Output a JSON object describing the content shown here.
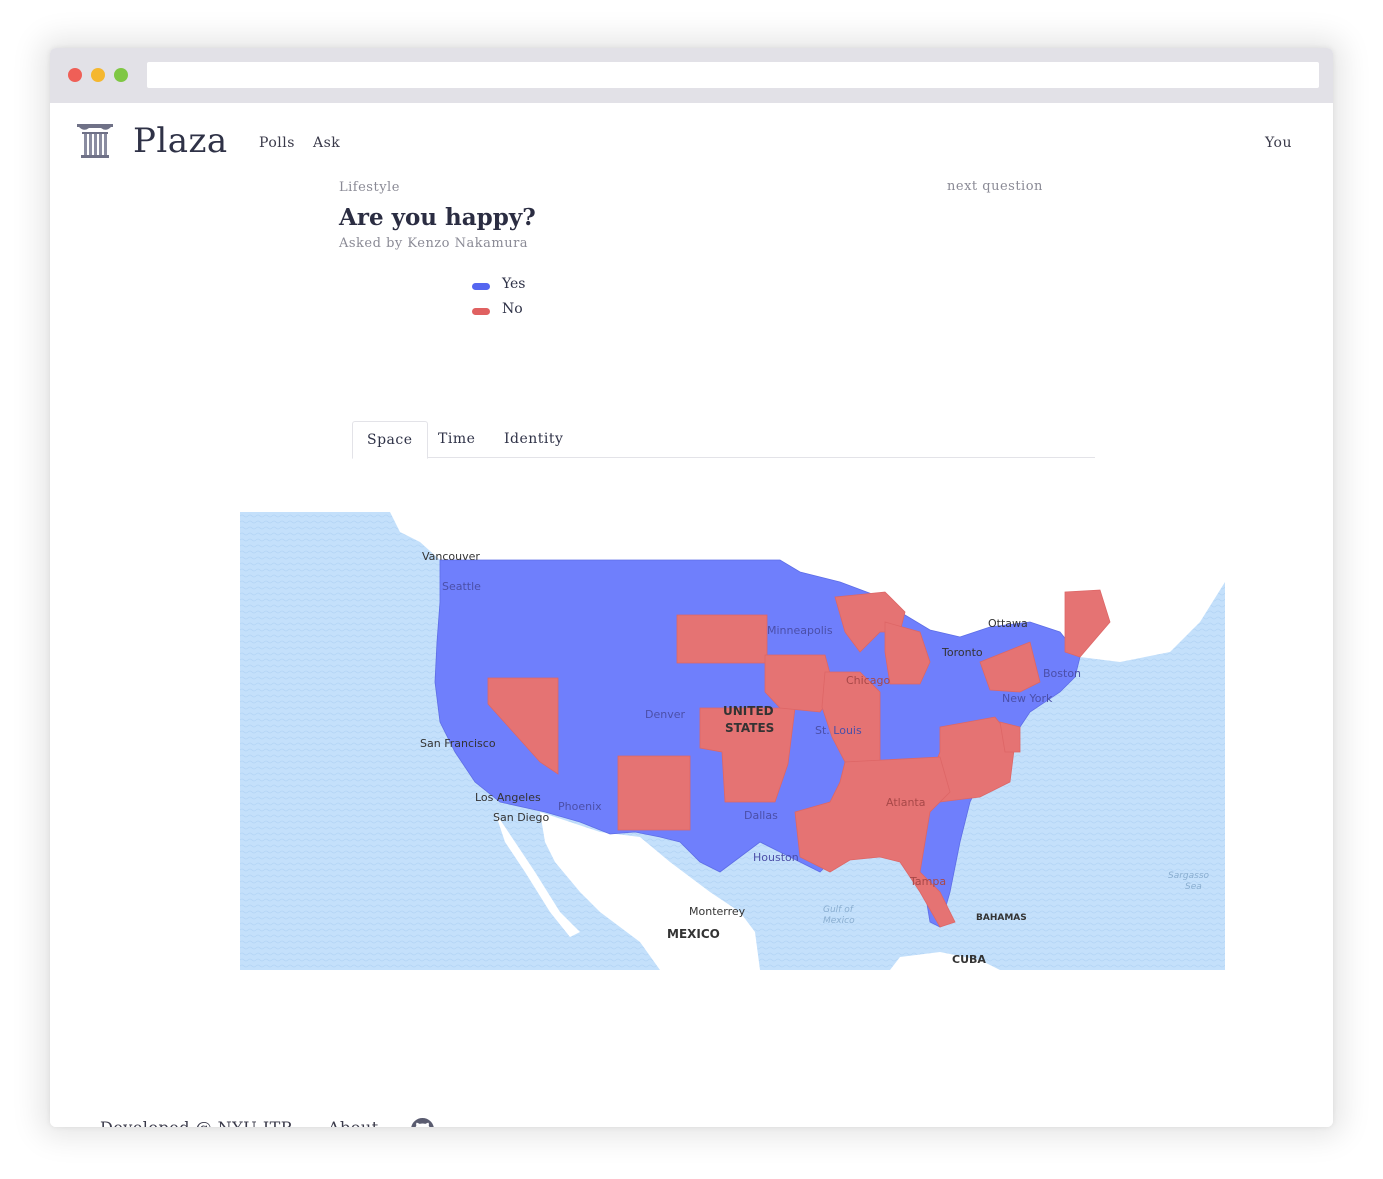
{
  "nav": {
    "brand": "Plaza",
    "links": [
      "Polls",
      "Ask"
    ],
    "user": "You"
  },
  "poll": {
    "category": "Lifestyle",
    "next_label": "next question",
    "question": "Are you happy?",
    "asked_by": "Asked by Kenzo Nakamura"
  },
  "legend": [
    {
      "label": "Yes",
      "color": "#5566f0"
    },
    {
      "label": "No",
      "color": "#e06161"
    }
  ],
  "tabs": [
    "Space",
    "Time",
    "Identity"
  ],
  "map": {
    "labels": [
      "Vancouver",
      "Seattle",
      "San Francisco",
      "Los Angeles",
      "San Diego",
      "Phoenix",
      "Denver",
      "UNITED",
      "STATES",
      "Minneapolis",
      "Chicago",
      "St. Louis",
      "Dallas",
      "Houston",
      "Atlanta",
      "Tampa",
      "Ottawa",
      "Toronto",
      "Boston",
      "New York",
      "Monterrey",
      "MEXICO",
      "BAHAMAS",
      "CUBA",
      "Gulf of",
      "Mexico",
      "Sargasso",
      "Sea"
    ]
  },
  "footer": {
    "developed": "Developed @ NYU ITP",
    "about": "About"
  }
}
